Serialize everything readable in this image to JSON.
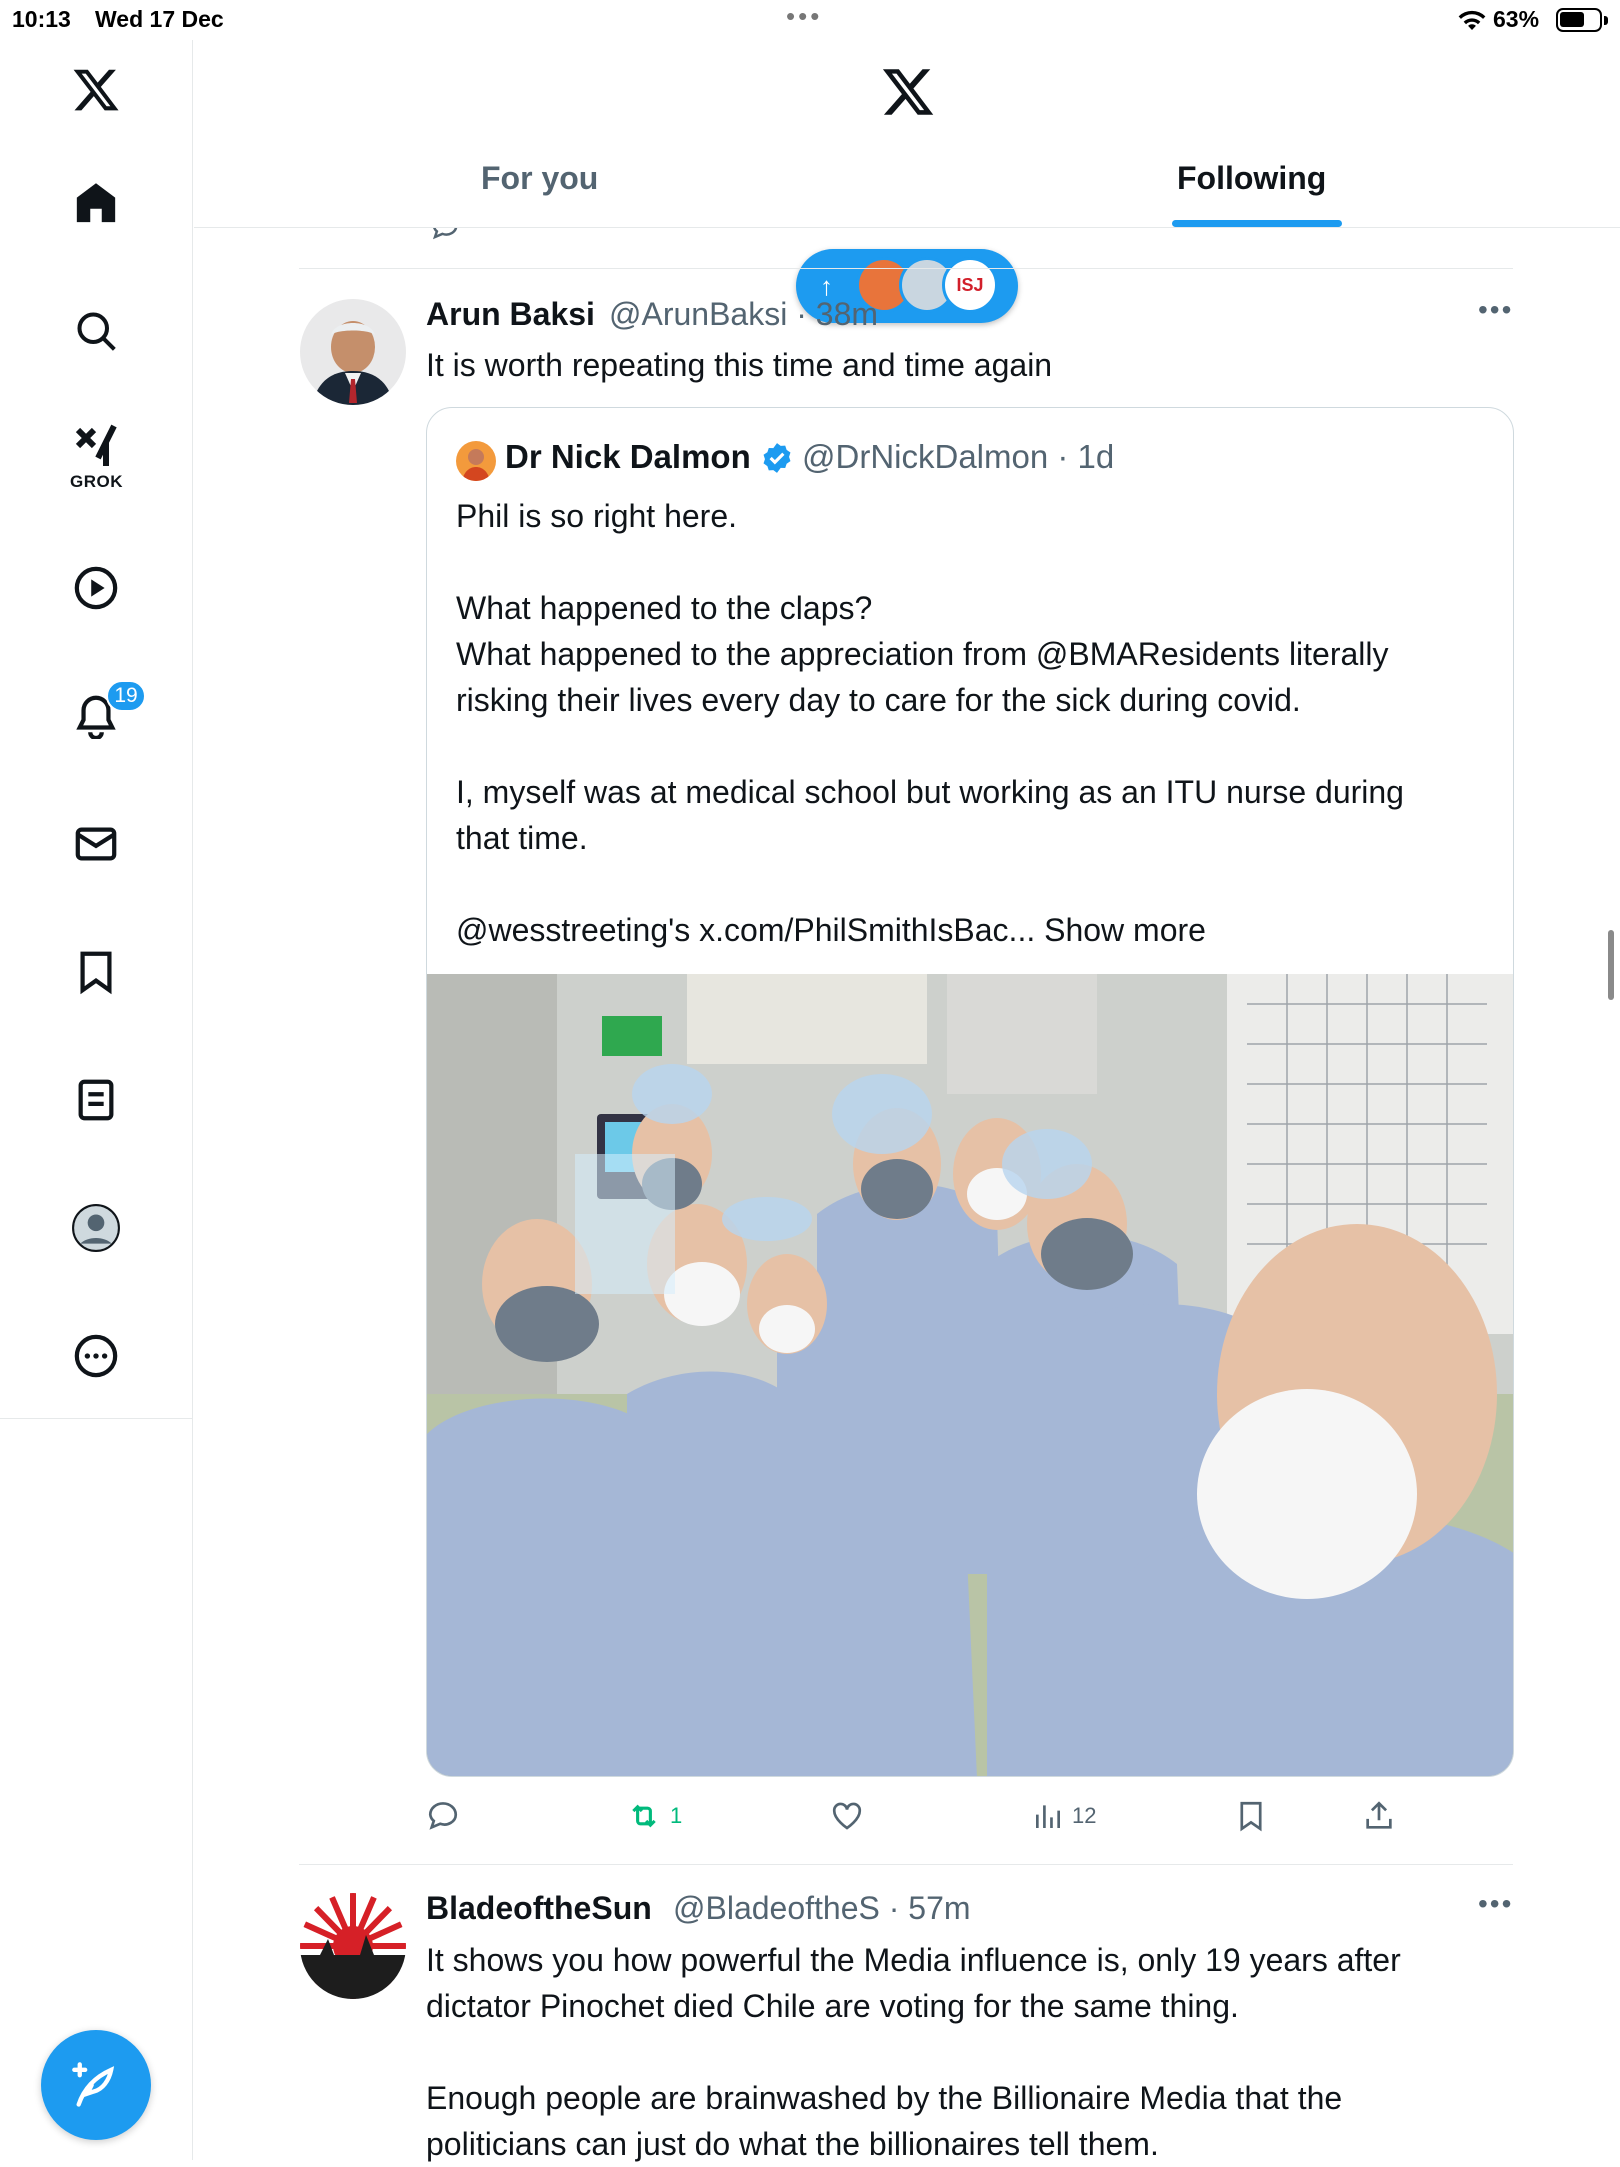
{
  "status_bar": {
    "time": "10:13",
    "date": "Wed 17 Dec",
    "battery": "63%"
  },
  "sidebar": {
    "items": [
      {
        "name": "x-logo"
      },
      {
        "name": "home"
      },
      {
        "name": "explore"
      },
      {
        "name": "grok",
        "label": "GROK"
      },
      {
        "name": "video"
      },
      {
        "name": "notifications",
        "badge": "19"
      },
      {
        "name": "messages"
      },
      {
        "name": "bookmarks"
      },
      {
        "name": "lists"
      },
      {
        "name": "profile"
      },
      {
        "name": "more"
      }
    ]
  },
  "header": {
    "tabs": [
      {
        "label": "For you"
      },
      {
        "label": "Following",
        "active": true
      }
    ]
  },
  "tweets": [
    {
      "name": "Arun Baksi",
      "handle": "@ArunBaksi · 38m",
      "text": "It is worth repeating this time and time again",
      "quote": {
        "name": "Dr Nick Dalmon",
        "handle": "@DrNickDalmon · 1d",
        "text": "Phil is so right here.\n\nWhat happened to the claps?\nWhat happened to the appreciation from @BMAResidents literally\nrisking their lives every day to care for the sick during covid.\n\nI, myself was at medical school but working as an ITU nurse during\nthat time.\n\n@wesstreeting's x.com/PhilSmithIsBac... Show more"
      },
      "stats": {
        "replies": "",
        "reposts": "1",
        "likes": "",
        "views": "12"
      }
    },
    {
      "name": "BladeoftheSun",
      "handle": "@BladeoftheS · 57m",
      "text": "It shows you how powerful the Media influence is, only 19 years after\ndictator Pinochet died Chile are voting for the same thing.\n\nEnough people are brainwashed by the Billionaire Media that the\npoliticians can just do what the billionaires tell them."
    }
  ],
  "new_posts_pill": {
    "label": "ISJ"
  },
  "colors": {
    "accent": "#1d9bf0",
    "text": "#0f1419",
    "muted": "#536471",
    "repost": "#00ba7c"
  }
}
